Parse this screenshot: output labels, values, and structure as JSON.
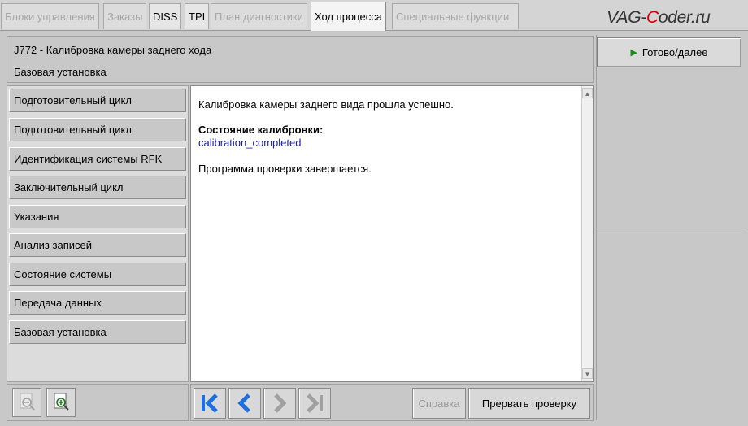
{
  "tabs": [
    {
      "label": "Блоки управления",
      "state": "disabled"
    },
    {
      "label": "Заказы",
      "state": "disabled"
    },
    {
      "label": "DISS",
      "state": "enabled"
    },
    {
      "label": "TPI",
      "state": "enabled"
    },
    {
      "label": "План диагностики",
      "state": "disabled"
    },
    {
      "label": "Ход процесса",
      "state": "active"
    },
    {
      "label": "Специальные функции",
      "state": "disabled"
    }
  ],
  "logo": {
    "part1": "VAG-",
    "part2": "C",
    "part3": "oder.ru"
  },
  "header": {
    "title": "J772 - Калибровка камеры заднего хода",
    "subtitle": "Базовая установка"
  },
  "ready_button": {
    "label": "Готово/далее"
  },
  "menu": {
    "items": [
      "Подготовительный цикл",
      "Подготовительный цикл",
      "Идентификация системы RFK",
      "Заключительный цикл",
      "Указания",
      "Анализ записей",
      "Состояние системы",
      "Передача данных",
      "Базовая установка"
    ]
  },
  "content": {
    "line1": "Калибровка камеры заднего вида прошла успешно.",
    "status_label": "Состояние калибровки:",
    "status_value": "calibration_completed",
    "line3": "Программа проверки завершается."
  },
  "buttons": {
    "help": "Справка",
    "abort": "Прервать проверку"
  },
  "colors": {
    "status_value": "#1a1ab4",
    "nav_active": "#1e6fe0",
    "nav_disabled": "#a0a0a0",
    "logo_accent": "#d20000",
    "play_arrow": "#1a8a1a"
  }
}
